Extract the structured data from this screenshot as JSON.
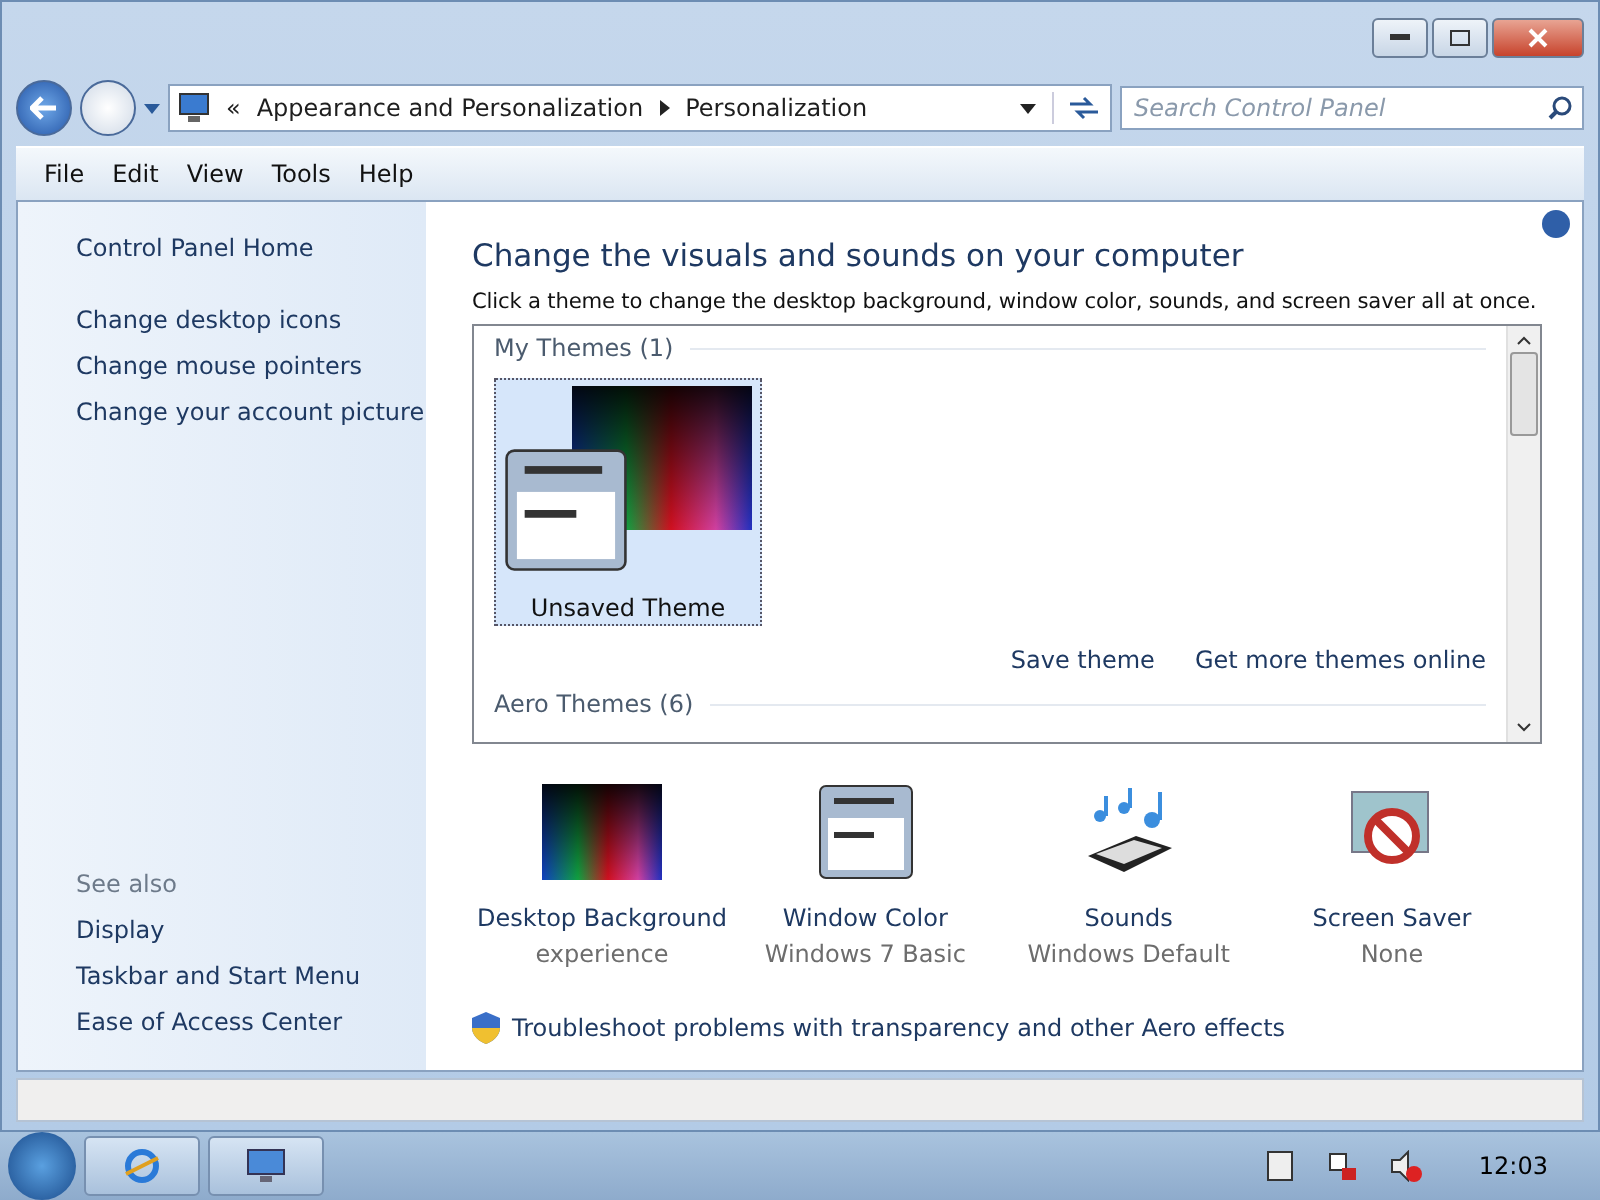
{
  "address_bar": {
    "overflow": "«",
    "crumbs": [
      "Appearance and Personalization",
      "Personalization"
    ]
  },
  "search": {
    "placeholder": "Search Control Panel"
  },
  "menu": [
    "File",
    "Edit",
    "View",
    "Tools",
    "Help"
  ],
  "sidebar": {
    "links": [
      "Control Panel Home",
      "Change desktop icons",
      "Change mouse pointers",
      "Change your account picture"
    ],
    "see_also_title": "See also",
    "see_also": [
      "Display",
      "Taskbar and Start Menu",
      "Ease of Access Center"
    ]
  },
  "main": {
    "title": "Change the visuals and sounds on your computer",
    "description": "Click a theme to change the desktop background, window color, sounds, and screen saver all at once.",
    "my_themes": {
      "heading": "My Themes (1)",
      "themes": [
        {
          "name": "Unsaved Theme",
          "selected": true
        }
      ]
    },
    "theme_links": [
      "Save theme",
      "Get more themes online"
    ],
    "aero_heading": "Aero Themes (6)",
    "settings": [
      {
        "kind": "background",
        "label": "Desktop Background",
        "value": "experience"
      },
      {
        "kind": "color",
        "label": "Window Color",
        "value": "Windows 7 Basic"
      },
      {
        "kind": "sounds",
        "label": "Sounds",
        "value": "Windows Default"
      },
      {
        "kind": "screensaver",
        "label": "Screen Saver",
        "value": "None"
      }
    ],
    "troubleshoot": "Troubleshoot problems with transparency and other Aero effects"
  },
  "taskbar": {
    "clock": "12:03"
  }
}
